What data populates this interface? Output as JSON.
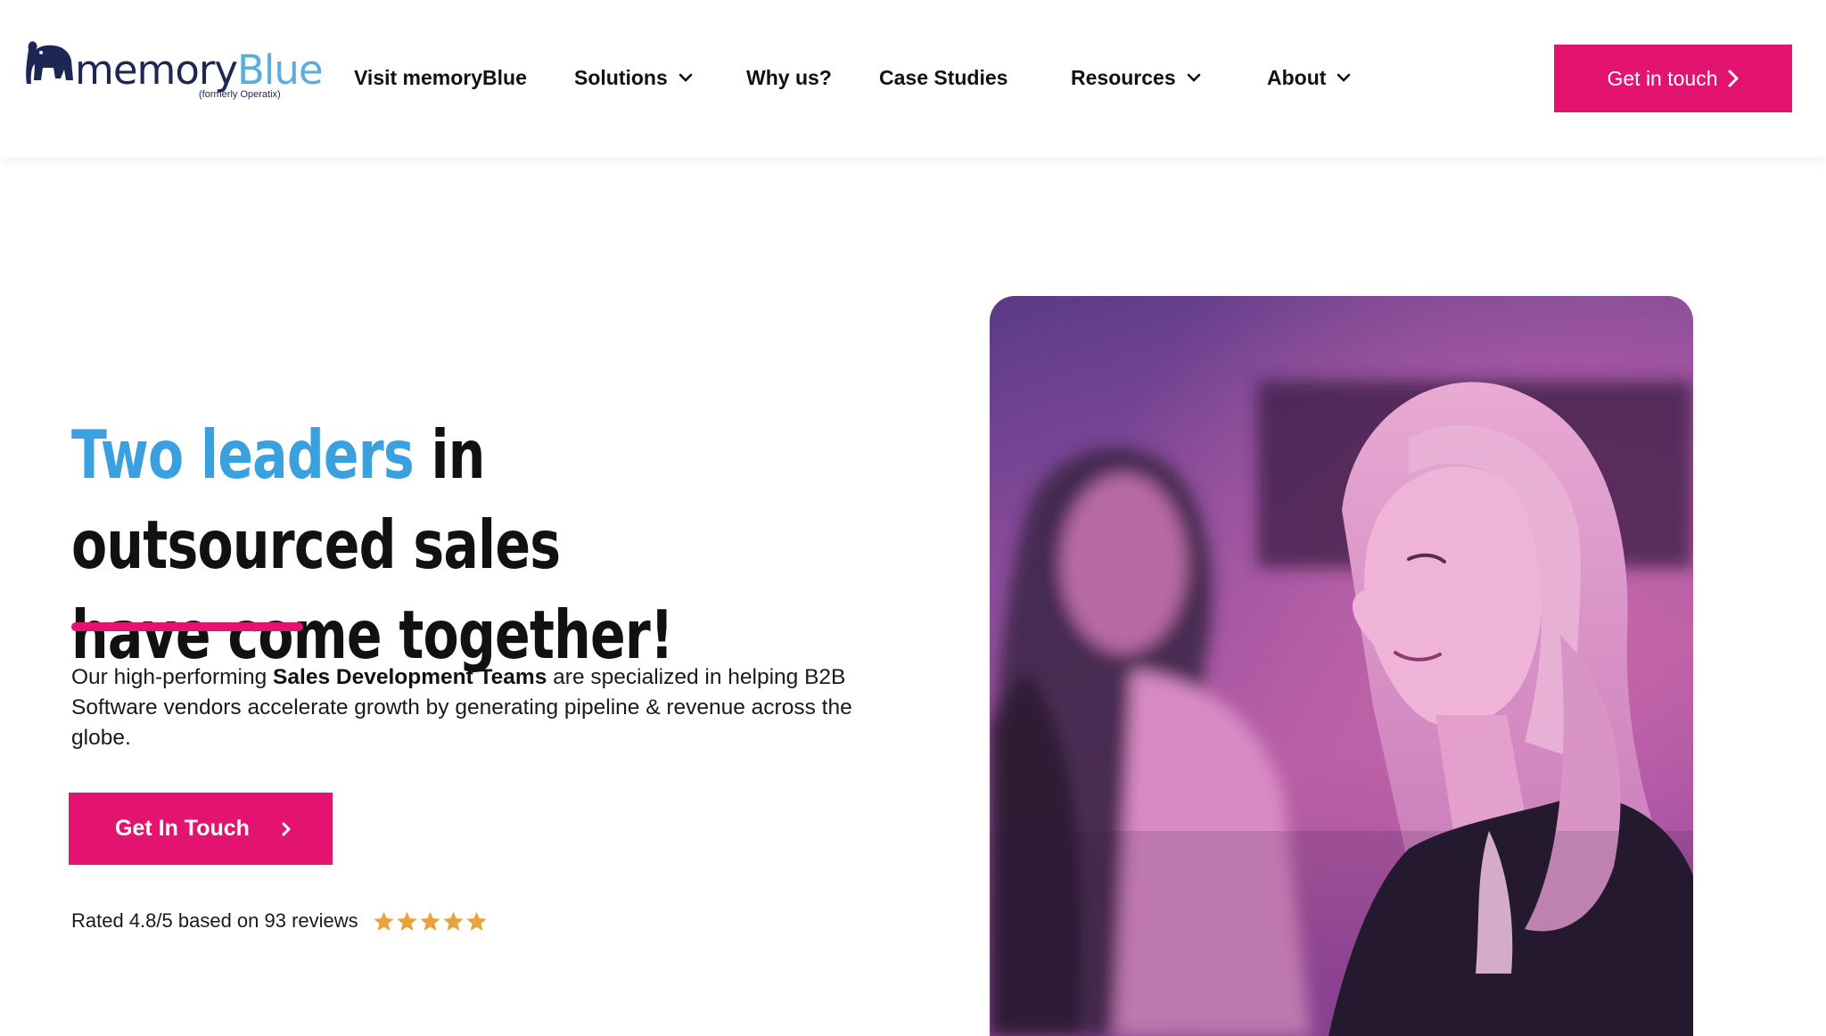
{
  "brand": {
    "name_part1": "memory",
    "name_part2": "Blue",
    "tagline": "(formerly Operatix)"
  },
  "nav": {
    "items": [
      {
        "label": "Visit memoryBlue",
        "has_dropdown": false
      },
      {
        "label": "Solutions",
        "has_dropdown": true
      },
      {
        "label": "Why us?",
        "has_dropdown": false
      },
      {
        "label": "Case Studies",
        "has_dropdown": false
      },
      {
        "label": "Resources",
        "has_dropdown": true
      },
      {
        "label": "About",
        "has_dropdown": true
      }
    ],
    "cta_label": "Get in touch"
  },
  "hero": {
    "headline_highlight": "Two leaders",
    "headline_rest": "in outsourced sales have come together!",
    "desc_prefix": "Our high-performing",
    "desc_bold": "Sales Development Teams",
    "desc_suffix": "are specialized in helping B2B Software vendors accelerate growth by generating pipeline & revenue across the globe.",
    "cta_label": "Get In Touch",
    "rating_text": "Rated 4.8/5 based on 93 reviews",
    "rating_value": 4.8,
    "rating_stars_shown": 5,
    "image_icon": "hero-photo-people"
  },
  "colors": {
    "accent_pink": "#e2146f",
    "headline_blue": "#39a1e0",
    "logo_navy": "#1c2754",
    "logo_blue": "#5aaedc",
    "star_gold": "#e8a33d"
  }
}
